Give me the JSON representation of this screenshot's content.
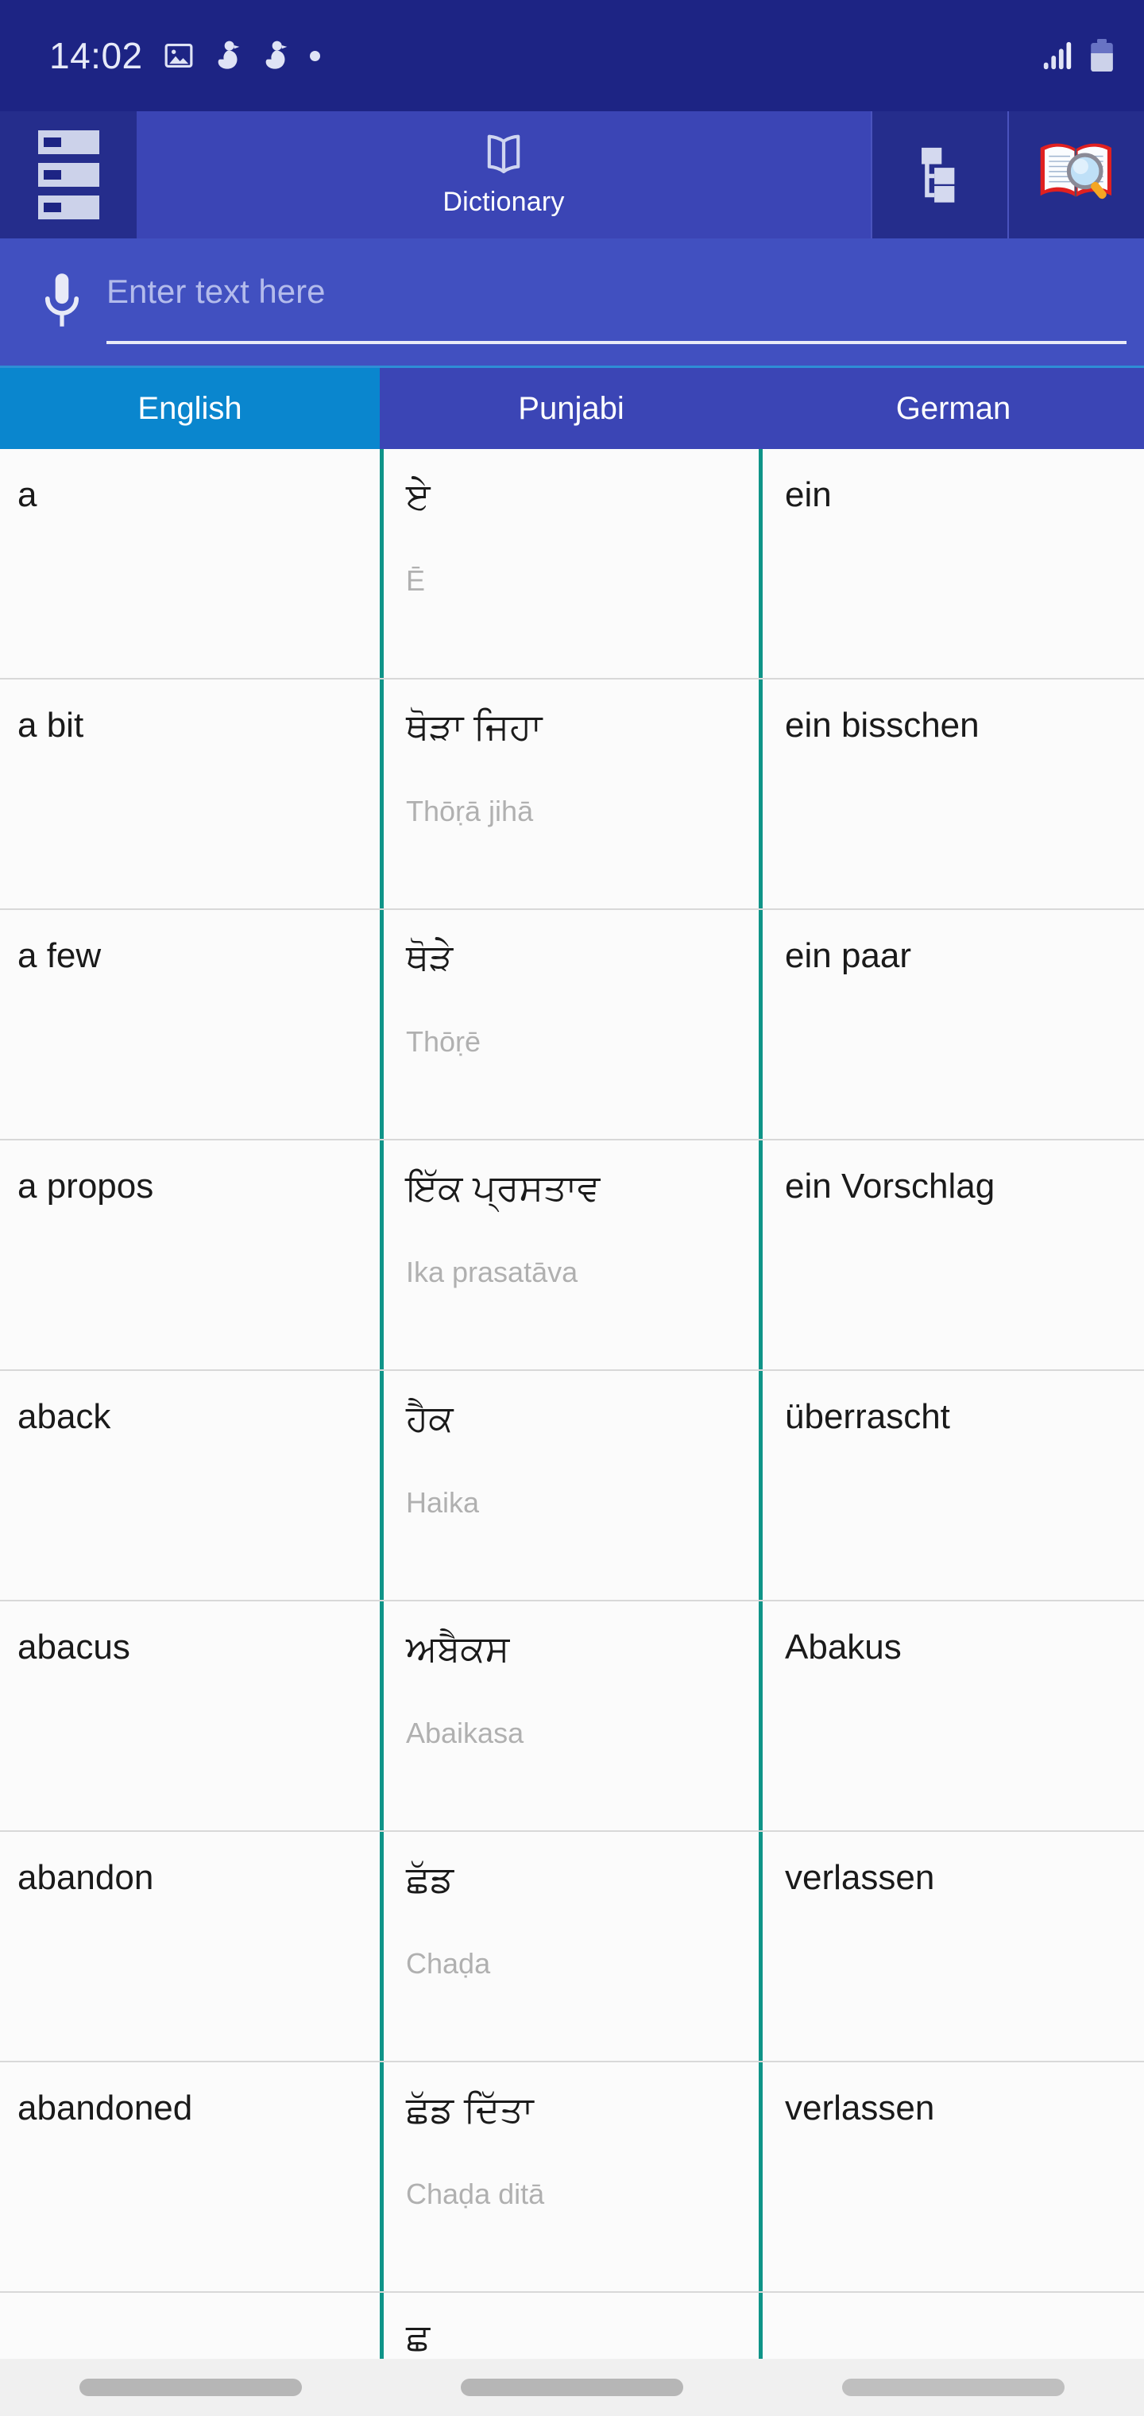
{
  "status_bar": {
    "clock": "14:02",
    "icons": [
      "image-icon",
      "duck-icon",
      "duck-icon",
      "dot-indicator",
      "signal-icon",
      "battery-icon"
    ]
  },
  "app_bar": {
    "menu_icon": "list-menu-icon",
    "tab_label": "Dictionary",
    "tab_icon": "open-book-icon",
    "tree_icon": "tree-hierarchy-icon",
    "book_search_icon": "book-magnifier-icon"
  },
  "search": {
    "placeholder": "Enter text here",
    "value": "",
    "mic_icon": "microphone-icon"
  },
  "columns": [
    {
      "label": "English",
      "active": true
    },
    {
      "label": "Punjabi",
      "active": false
    },
    {
      "label": "German",
      "active": false
    }
  ],
  "rows": [
    {
      "english": "a",
      "punjabi": "ਏ",
      "translit": "Ē",
      "german": "ein"
    },
    {
      "english": "a bit",
      "punjabi": "ਥੋੜਾ ਜਿਹਾ",
      "translit": "Thōṛā jihā",
      "german": "ein bisschen"
    },
    {
      "english": "a few",
      "punjabi": "ਥੋੜੇ",
      "translit": "Thōṛē",
      "german": "ein paar"
    },
    {
      "english": "a propos",
      "punjabi": "ਇੱਕ ਪ੍ਰਸਤਾਵ",
      "translit": "Ika prasatāva",
      "german": "ein Vorschlag"
    },
    {
      "english": "aback",
      "punjabi": "ਹੈਕ",
      "translit": "Haika",
      "german": "überrascht"
    },
    {
      "english": "abacus",
      "punjabi": "ਅਬੈਕਸ",
      "translit": "Abaikasa",
      "german": "Abakus"
    },
    {
      "english": "abandon",
      "punjabi": "ਛੱਡ",
      "translit": "Chaḍa",
      "german": "verlassen"
    },
    {
      "english": "abandoned",
      "punjabi": "ਛੱਡ ਦਿੱਤਾ",
      "translit": "Chaḍa ditā",
      "german": "verlassen"
    }
  ],
  "partial_row": {
    "english": "",
    "punjabi": "ਛ",
    "translit": "",
    "german": ""
  },
  "nav_bar": {
    "recents": "recents-button",
    "home": "home-button",
    "back": "back-button"
  },
  "colors": {
    "status_bg": "#1d2484",
    "appbar_bg": "#252d8c",
    "tab_active_bg": "#3b45b5",
    "search_bg": "#4150c0",
    "header_active_bg": "#0a86ce",
    "divider_teal": "#0f9488",
    "table_bg": "#fbfbfb"
  }
}
